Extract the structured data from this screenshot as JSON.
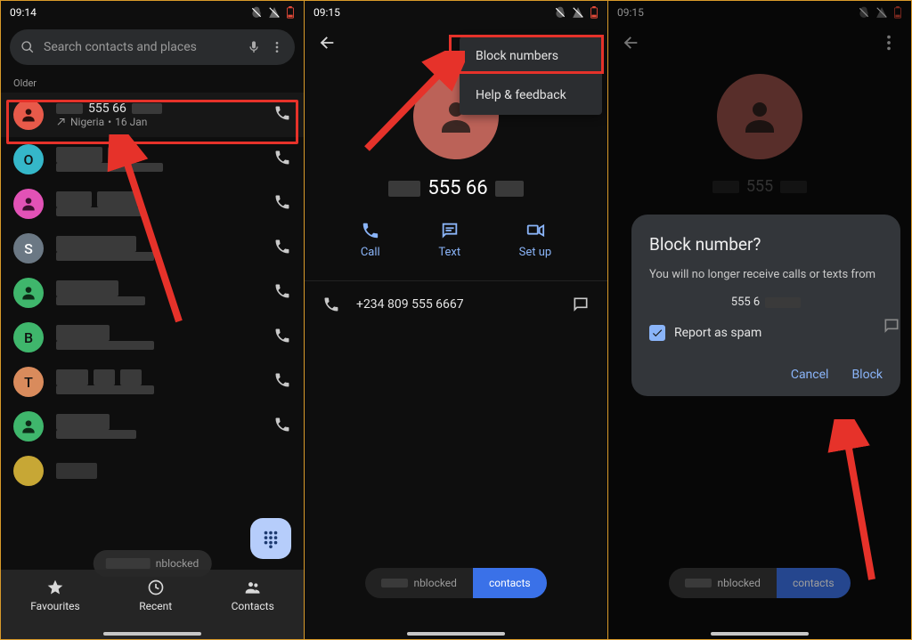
{
  "status": {
    "time1": "09:14",
    "time2": "09:15",
    "time3": "09:15"
  },
  "screen1": {
    "search_placeholder": "Search contacts and places",
    "section_older": "Older",
    "top_call": {
      "number_suffix": " 555 66",
      "sub_location": "Nigeria",
      "sub_date": "16 Jan"
    },
    "avatar_letters": [
      "O",
      "",
      "S",
      "",
      "B",
      "T",
      "",
      ""
    ],
    "nav": {
      "fav": "Favourites",
      "recent": "Recent",
      "contacts": "Contacts"
    },
    "toast": "nblocked"
  },
  "screen2": {
    "menu": {
      "block": "Block numbers",
      "help": "Help & feedback"
    },
    "number_mid": " 555 66",
    "actions": {
      "call": "Call",
      "text": "Text",
      "setup": "Set up"
    },
    "detail_number": "+234 809 555 6667",
    "toast": "nblocked",
    "pill_contacts": "contacts"
  },
  "screen3": {
    "number_mid": "555",
    "dialog": {
      "title": "Block number?",
      "body": "You will no longer receive calls or texts from",
      "number": "555 6",
      "spam": "Report as spam",
      "cancel": "Cancel",
      "block": "Block"
    },
    "toast": "nblocked",
    "pill_contacts": "contacts"
  }
}
